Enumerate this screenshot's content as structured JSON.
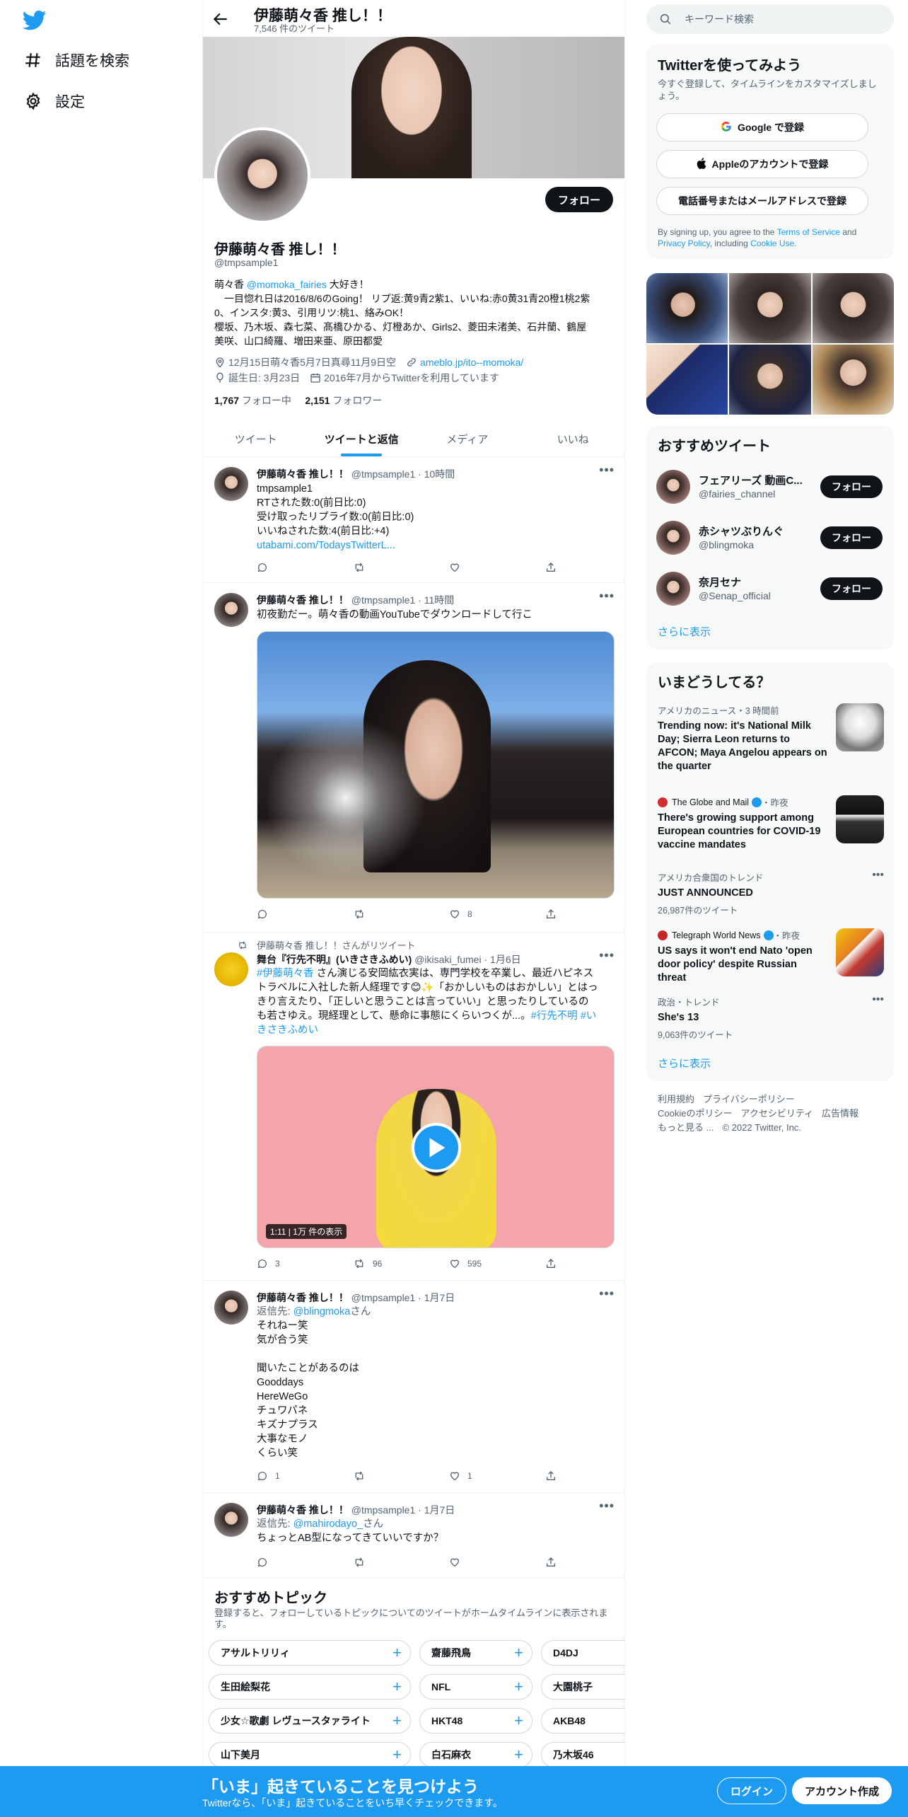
{
  "nav": {
    "explore": "話題を検索",
    "settings": "設定"
  },
  "header": {
    "title": "伊藤萌々香 推し！！",
    "tweet_count": "7,546 件のツイート"
  },
  "profile": {
    "follow_label": "フォロー",
    "name": "伊藤萌々香 推し！！",
    "handle": "@tmpsample1",
    "bio": {
      "l1_pre": "萌々香 ",
      "l1_mention": "@momoka_fairies",
      "l1_post": " 大好き！",
      "l2": "　一目惚れ日は2016/8/6のGoing！ リプ返:黄9青2紫1、いいね:赤0黄31青20橙1桃2紫",
      "l3": "0、インスタ:黄3、引用リツ:桃1、絡みOK！",
      "l4": "櫻坂、乃木坂、森七菜、髙橋ひかる、灯橙あか、Girls2、菱田未渚美、石井蘭、鶴屋",
      "l5": "美咲、山口綺羅、増田来亜、原田都愛"
    },
    "location": "12月15日萌々香5月7日真尋11月9日空",
    "link": "ameblo.jp/ito--momoka/",
    "birthday": "誕生日: 3月23日",
    "joined": "2016年7月からTwitterを利用しています",
    "following_count": "1,767",
    "following_label": "フォロー中",
    "followers_count": "2,151",
    "followers_label": "フォロワー"
  },
  "tabs": [
    "ツイート",
    "ツイートと返信",
    "メディア",
    "いいね"
  ],
  "tweets": [
    {
      "name": "伊藤萌々香 推し！！",
      "handle": "@tmpsample1",
      "time": "10時間",
      "lines": [
        "tmpsample1",
        "RTされた数:0(前日比:0)",
        "受け取ったリプライ数:0(前日比:0)",
        "いいねされた数:4(前日比:+4)"
      ],
      "link": "utabami.com/TodaysTwitterL..."
    },
    {
      "name": "伊藤萌々香 推し！！",
      "handle": "@tmpsample1",
      "time": "11時間",
      "text": "初夜勤だー。萌々香の動画YouTubeでダウンロードして行こ",
      "likes": "8"
    },
    {
      "retweet_label": "伊藤萌々香 推し！！さんがリツイート",
      "name": "舞台『行先不明』(いきさきふめい)",
      "handle": "@ikisaki_fumei",
      "time": "1月6日",
      "hashtag1": "#伊藤萌々香",
      "text1": " さん演じる安岡紘衣実は、専門学校を卒業し、最近ハピネス",
      "text2": "トラベルに入社した新人経理です😊✨「おかしいものはおかしい」とはっ",
      "text3": "きり言えたり、「正しいと思うことは言っていい」と思ったりしているの",
      "text4_pre": "も若さゆえ。現経理として、懸命に事態にくらいつくが...。",
      "text4_tag": "#行先不明 #い",
      "text5_tag": "きさきふめい",
      "video_duration": "1:11",
      "video_views": "1万 件の表示",
      "replies": "3",
      "retweets": "96",
      "likes": "595"
    },
    {
      "name": "伊藤萌々香 推し！！",
      "handle": "@tmpsample1",
      "time": "1月7日",
      "reply_prefix": "返信先: ",
      "reply_to": "@blingmoka",
      "reply_suffix": "さん",
      "lines": [
        "それねー笑",
        "気が合う笑",
        "",
        "聞いたことがあるのは",
        "Gooddays",
        "HereWeGo",
        "チュワパネ",
        "キズナプラス",
        "大事なモノ",
        "くらい笑"
      ],
      "replies": "1",
      "likes": "1"
    },
    {
      "name": "伊藤萌々香 推し！！",
      "handle": "@tmpsample1",
      "time": "1月7日",
      "reply_prefix": "返信先: ",
      "reply_to": "@mahirodayo_",
      "reply_suffix": "さん",
      "text": "ちょっとAB型になってきていいですか？"
    }
  ],
  "topics": {
    "title": "おすすめトピック",
    "subtitle": "登録すると、フォローしているトピックについてのツイートがホームタイムラインに表示されます。",
    "chips": [
      "アサルトリリィ",
      "齋藤飛鳥",
      "D4DJ",
      "生田絵梨花",
      "NFL",
      "大園桃子",
      "少女☆歌劇 レヴュースタァライト",
      "HKT48",
      "AKB48",
      "山下美月",
      "白石麻衣",
      "乃木坂46"
    ]
  },
  "sidebar": {
    "search_placeholder": "キーワード検索",
    "signup": {
      "title": "Twitterを使ってみよう",
      "desc": "今すぐ登録して、タイムラインをカスタマイズしましょう。",
      "google": "Google で登録",
      "apple": "Appleのアカウントで登録",
      "phone": "電話番号またはメールアドレスで登録",
      "legal_pre": "By signing up, you agree to the ",
      "terms": "Terms of Service",
      "and": " and ",
      "privacy": "Privacy Policy",
      "including": ", including ",
      "cookie": "Cookie Use."
    },
    "recommended": {
      "title": "おすすめツイート",
      "accounts": [
        {
          "name": "フェアリーズ 動画C...",
          "handle": "@fairies_channel",
          "follow": "フォロー"
        },
        {
          "name": "赤シャツぶりんぐ",
          "handle": "@blingmoka",
          "follow": "フォロー"
        },
        {
          "name": "奈月セナ",
          "handle": "@Senap_official",
          "follow": "フォロー"
        }
      ],
      "show_more": "さらに表示"
    },
    "trends": {
      "title": "いまどうしてる？",
      "items": [
        {
          "context": "アメリカのニュース・3 時間前",
          "title": "Trending now: it's National Milk Day; Sierra Leon returns to AFCON; Maya Angelou appears on the quarter"
        },
        {
          "context_name": "The Globe and Mail",
          "context_time": "・昨夜",
          "title": "There's growing support among European countries for COVID-19 vaccine mandates"
        },
        {
          "context": "アメリカ合衆国のトレンド",
          "title": "JUST ANNOUNCED",
          "sub": "26,987件のツイート"
        },
        {
          "context_name": "Telegraph World News",
          "context_time": "・昨夜",
          "title": "US says it won't end Nato 'open door policy' despite Russian threat"
        },
        {
          "context": "政治・トレンド",
          "title": "She's 13",
          "sub": "9,063件のツイート"
        }
      ],
      "show_more": "さらに表示"
    },
    "footer": {
      "tos": "利用規約",
      "privacy": "プライバシーポリシー",
      "cookie": "Cookieのポリシー",
      "accessibility": "アクセシビリティ",
      "ads": "広告情報",
      "more": "もっと見る ...",
      "copyright": "© 2022 Twitter, Inc."
    }
  },
  "bottombar": {
    "title": "「いま」起きていることを見つけよう",
    "subtitle": "Twitterなら、「いま」起きていることをいち早くチェックできます。",
    "login": "ログイン",
    "signup": "アカウント作成"
  },
  "colors": {
    "accent": "#1d9bf0",
    "text": "#0f1419",
    "secondary": "#536471",
    "dark_button": "#0f1419"
  }
}
